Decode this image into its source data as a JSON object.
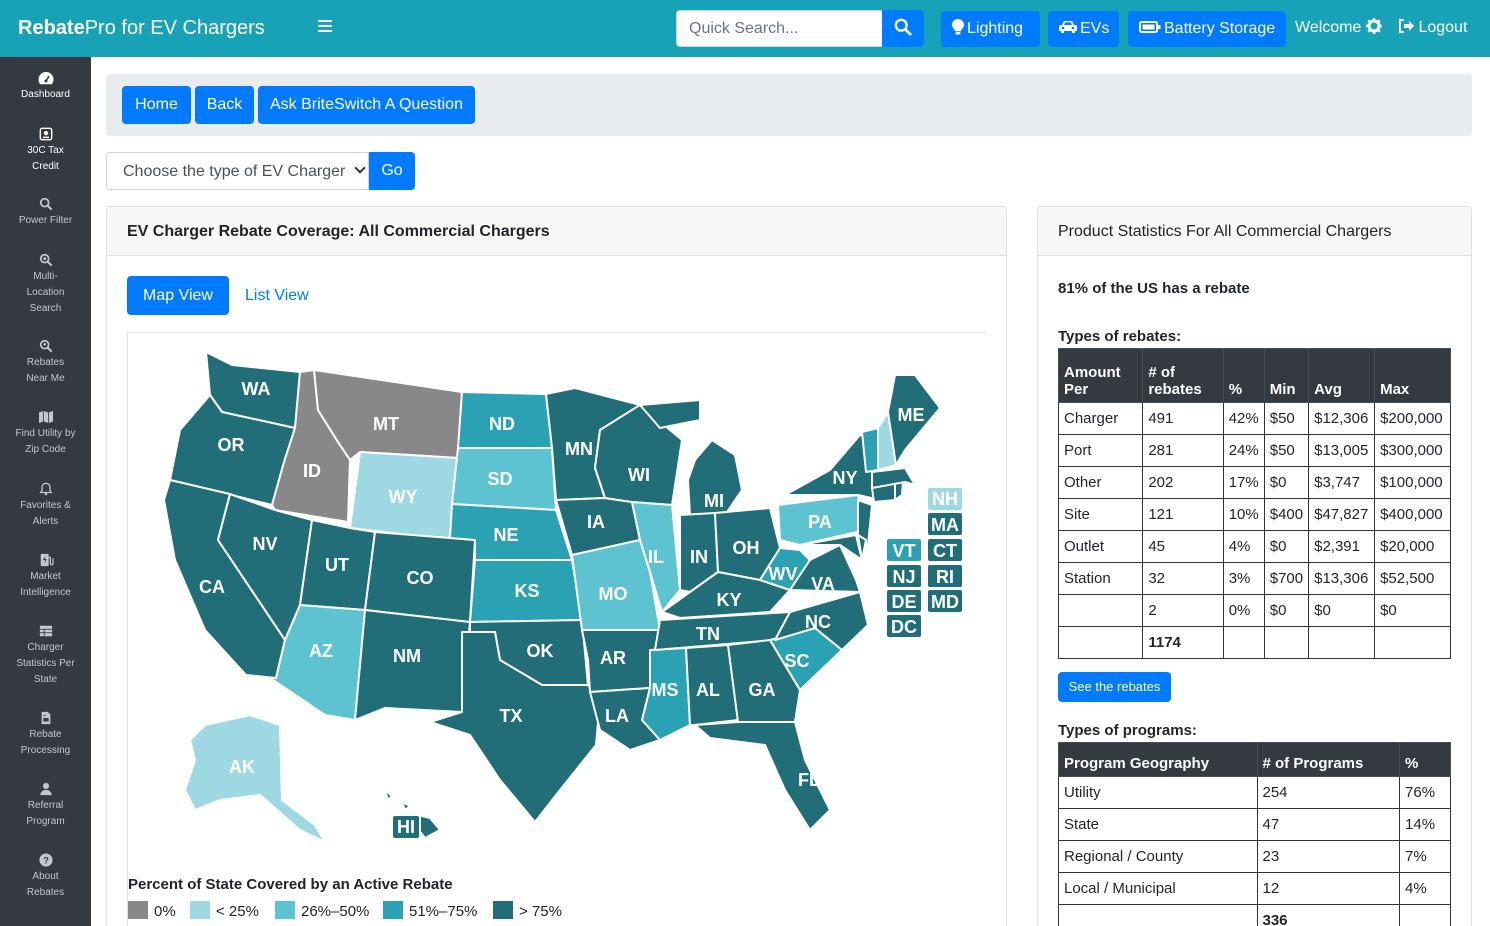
{
  "header": {
    "brand_bold": "Rebate",
    "brand_rest": "Pro for EV Chargers",
    "search_placeholder": "Quick Search...",
    "buttons": {
      "lighting": "Lighting",
      "evs": "EVs",
      "battery": "Battery Storage"
    },
    "welcome": "Welcome",
    "logout": "Logout"
  },
  "sidebar": {
    "items": [
      {
        "label": "Dashboard",
        "icon": "gauge-icon"
      },
      {
        "label": "30C Tax Credit",
        "icon": "receipt-icon"
      },
      {
        "label": "Power Filter",
        "icon": "search-icon"
      },
      {
        "label": "Multi-Location Search",
        "icon": "search-plus-icon"
      },
      {
        "label": "Rebates Near Me",
        "icon": "search-location-icon"
      },
      {
        "label": "Find Utility by Zip Code",
        "icon": "map-icon"
      },
      {
        "label": "Favorites & Alerts",
        "icon": "bell-icon"
      },
      {
        "label": "Market Intelligence",
        "icon": "charging-station-icon"
      },
      {
        "label": "Charger Statistics Per State",
        "icon": "table-icon"
      },
      {
        "label": "Rebate Processing",
        "icon": "file-invoice-icon"
      },
      {
        "label": "Referral Program",
        "icon": "user-icon"
      },
      {
        "label": "About Rebates",
        "icon": "question-circle-icon"
      }
    ]
  },
  "nav": {
    "home": "Home",
    "back": "Back",
    "ask": "Ask BriteSwitch A Question"
  },
  "charger_select": {
    "value": "Choose the type of EV Charger",
    "go": "Go"
  },
  "coverage_card": {
    "title": "EV Charger Rebate Coverage: All Commercial Chargers",
    "tabs": {
      "map": "Map View",
      "list": "List View"
    },
    "legend_title": "Percent of State Covered by an Active Rebate",
    "legend": [
      {
        "label": "0%",
        "color": "#888888"
      },
      {
        "label": "< 25%",
        "color": "#9ed9e3"
      },
      {
        "label": "26%–50%",
        "color": "#5ec3d1"
      },
      {
        "label": "51%–75%",
        "color": "#2ba2b3"
      },
      {
        "label": "> 75%",
        "color": "#216d78"
      }
    ],
    "small_states": [
      "NH",
      "MA",
      "VT",
      "CT",
      "NJ",
      "RI",
      "DE",
      "MD",
      "DC"
    ],
    "map_states": [
      "WA",
      "OR",
      "CA",
      "ID",
      "NV",
      "MT",
      "WY",
      "UT",
      "AZ",
      "CO",
      "NM",
      "ND",
      "SD",
      "NE",
      "KS",
      "OK",
      "TX",
      "MN",
      "IA",
      "MO",
      "AR",
      "LA",
      "WI",
      "IL",
      "MS",
      "MI",
      "IN",
      "KY",
      "TN",
      "AL",
      "OH",
      "GA",
      "FL",
      "WV",
      "VA",
      "NC",
      "SC",
      "PA",
      "NY",
      "ME",
      "AK",
      "HI"
    ]
  },
  "stats_card": {
    "title": "Product Statistics For All Commercial Chargers",
    "coverage_text": "81% of the US has a rebate",
    "rebate_types_title": "Types of rebates:",
    "rebate_headers": [
      "Amount Per",
      "# of rebates",
      "%",
      "Min",
      "Avg",
      "Max"
    ],
    "rebate_rows": [
      [
        "Charger",
        "491",
        "42%",
        "$50",
        "$12,306",
        "$200,000"
      ],
      [
        "Port",
        "281",
        "24%",
        "$50",
        "$13,005",
        "$300,000"
      ],
      [
        "Other",
        "202",
        "17%",
        "$0",
        "$3,747",
        "$100,000"
      ],
      [
        "Site",
        "121",
        "10%",
        "$400",
        "$47,827",
        "$400,000"
      ],
      [
        "Outlet",
        "45",
        "4%",
        "$0",
        "$2,391",
        "$20,000"
      ],
      [
        "Station",
        "32",
        "3%",
        "$700",
        "$13,306",
        "$52,500"
      ],
      [
        "",
        "2",
        "0%",
        "$0",
        "$0",
        "$0"
      ]
    ],
    "rebate_total": "1174",
    "see_rebates": "See the rebates",
    "program_types_title": "Types of programs:",
    "program_headers": [
      "Program Geography",
      "# of Programs",
      "%"
    ],
    "program_rows": [
      [
        "Utility",
        "254",
        "76%"
      ],
      [
        "State",
        "47",
        "14%"
      ],
      [
        "Regional / County",
        "23",
        "7%"
      ],
      [
        "Local / Municipal",
        "12",
        "4%"
      ]
    ],
    "program_total": "336"
  }
}
